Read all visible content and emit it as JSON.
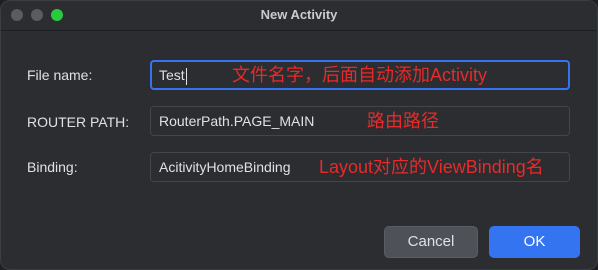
{
  "window": {
    "title": "New Activity"
  },
  "form": {
    "file_name": {
      "label": "File name:",
      "value": "Test",
      "annotation": "文件名字，后面自动添加Activity"
    },
    "router_path": {
      "label": "ROUTER PATH:",
      "value": "RouterPath.PAGE_MAIN",
      "annotation": "路由路径"
    },
    "binding": {
      "label": "Binding:",
      "value": "AcitivityHomeBinding",
      "annotation": "Layout对应的ViewBinding名"
    }
  },
  "buttons": {
    "cancel": "Cancel",
    "ok": "OK"
  },
  "colors": {
    "accent": "#3574f0",
    "annotation": "#e82a2a",
    "window_bg": "#2b2d30"
  }
}
